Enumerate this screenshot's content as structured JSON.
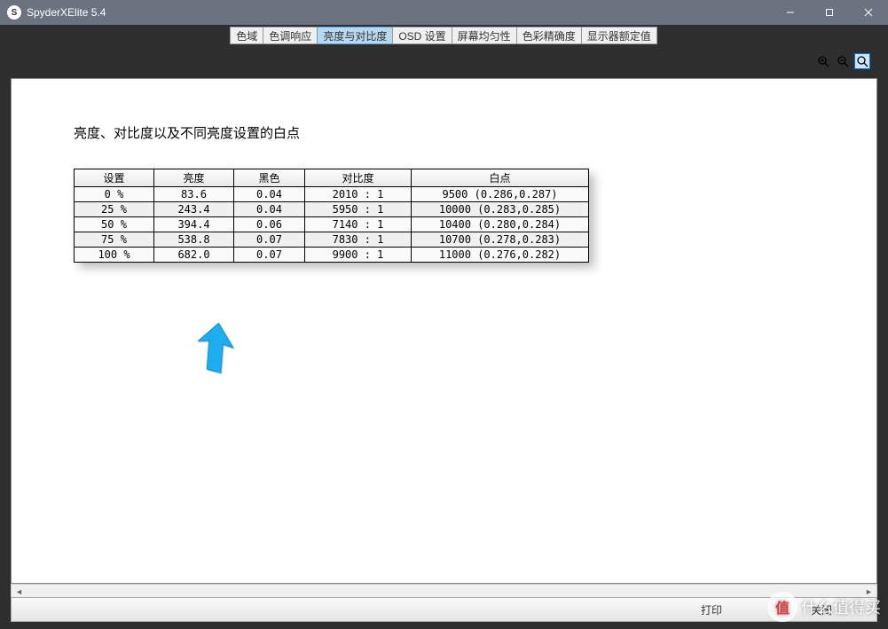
{
  "window": {
    "title": "SpyderXElite 5.4",
    "icon_letter": "S"
  },
  "tabs": [
    {
      "label": "色域",
      "active": false
    },
    {
      "label": "色调响应",
      "active": false
    },
    {
      "label": "亮度与对比度",
      "active": true
    },
    {
      "label": "OSD 设置",
      "active": false
    },
    {
      "label": "屏幕均匀性",
      "active": false
    },
    {
      "label": "色彩精确度",
      "active": false
    },
    {
      "label": "显示器额定值",
      "active": false
    }
  ],
  "heading": "亮度、对比度以及不同亮度设置的白点",
  "columns": {
    "setting": "设置",
    "brightness": "亮度",
    "black": "黑色",
    "contrast": "对比度",
    "whitepoint": "白点"
  },
  "rows": [
    {
      "setting": "0 %",
      "brightness": "83.6",
      "black": "0.04",
      "contrast": "2010 : 1",
      "whitepoint": "9500 (0.286,0.287)"
    },
    {
      "setting": "25 %",
      "brightness": "243.4",
      "black": "0.04",
      "contrast": "5950 : 1",
      "whitepoint": "10000 (0.283,0.285)"
    },
    {
      "setting": "50 %",
      "brightness": "394.4",
      "black": "0.06",
      "contrast": "7140 : 1",
      "whitepoint": "10400 (0.280,0.284)"
    },
    {
      "setting": "75 %",
      "brightness": "538.8",
      "black": "0.07",
      "contrast": "7830 : 1",
      "whitepoint": "10700 (0.278,0.283)"
    },
    {
      "setting": "100 %",
      "brightness": "682.0",
      "black": "0.07",
      "contrast": "9900 : 1",
      "whitepoint": "11000 (0.276,0.282)"
    }
  ],
  "footer": {
    "print": "打印",
    "close": "关闭"
  },
  "watermark": {
    "badge": "值",
    "text": "什么值得买"
  },
  "chart_data": {
    "type": "table",
    "title": "亮度、对比度以及不同亮度设置的白点",
    "columns": [
      "设置",
      "亮度",
      "黑色",
      "对比度",
      "白点"
    ],
    "data": [
      [
        "0 %",
        83.6,
        0.04,
        "2010 : 1",
        "9500 (0.286,0.287)"
      ],
      [
        "25 %",
        243.4,
        0.04,
        "5950 : 1",
        "10000 (0.283,0.285)"
      ],
      [
        "50 %",
        394.4,
        0.06,
        "7140 : 1",
        "10400 (0.280,0.284)"
      ],
      [
        "75 %",
        538.8,
        0.07,
        "7830 : 1",
        "10700 (0.278,0.283)"
      ],
      [
        "100 %",
        682.0,
        0.07,
        "9900 : 1",
        "11000 (0.276,0.282)"
      ]
    ]
  }
}
